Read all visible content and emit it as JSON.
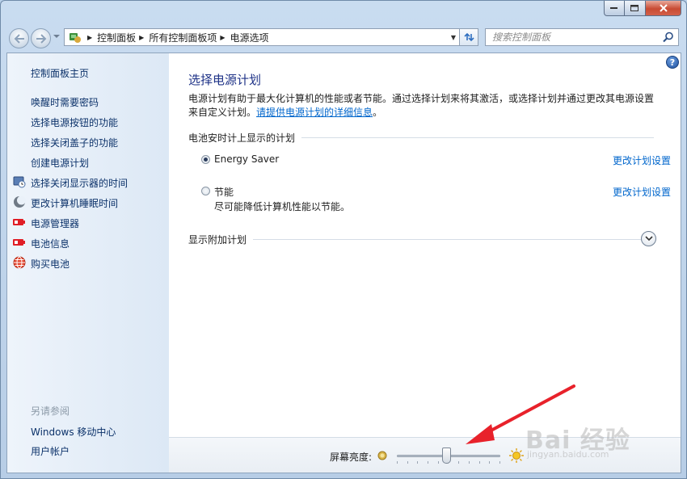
{
  "window": {
    "minimize_label": "—",
    "close_label": "✕"
  },
  "navbar": {
    "breadcrumbs": [
      "控制面板",
      "所有控制面板项",
      "电源选项"
    ],
    "search_placeholder": "搜索控制面板"
  },
  "sidebar": {
    "home_label": "控制面板主页",
    "links": [
      {
        "label": "唤醒时需要密码",
        "icon": ""
      },
      {
        "label": "选择电源按钮的功能",
        "icon": ""
      },
      {
        "label": "选择关闭盖子的功能",
        "icon": ""
      },
      {
        "label": "创建电源计划",
        "icon": ""
      },
      {
        "label": "选择关闭显示器的时间",
        "icon": "monitor-clock-icon"
      },
      {
        "label": "更改计算机睡眠时间",
        "icon": "moon-icon"
      },
      {
        "label": "电源管理器",
        "icon": "battery-red-icon"
      },
      {
        "label": "电池信息",
        "icon": "battery-red-icon"
      },
      {
        "label": "购买电池",
        "icon": "globe-icon"
      }
    ],
    "see_also_heading": "另请参阅",
    "see_also_links": [
      "Windows 移动中心",
      "用户帐户"
    ]
  },
  "main": {
    "title": "选择电源计划",
    "intro_text": "电源计划有助于最大化计算机的性能或者节能。通过选择计划来将其激活，或选择计划并通过更改其电源设置来自定义计划。",
    "intro_link": "请提供电源计划的详细信息",
    "intro_period": "。",
    "battery_section_heading": "电池安时计上显示的计划",
    "plans": [
      {
        "name": "Energy Saver",
        "description": "",
        "checked": true,
        "change_label": "更改计划设置"
      },
      {
        "name": "节能",
        "description": "尽可能降低计算机性能以节能。",
        "checked": false,
        "change_label": "更改计划设置"
      }
    ],
    "additional_plans_heading": "显示附加计划",
    "help_label": "?"
  },
  "bottom_bar": {
    "brightness_label": "屏幕亮度:",
    "brightness_level_percent": 48
  },
  "watermark": {
    "logo_text": "Bai 经验",
    "url_text": "jingyan.baidu.com"
  },
  "colors": {
    "title_blue": "#1e3287",
    "link_blue": "#0066cc",
    "sidebar_link": "#0c326a",
    "annotation_red": "#e8222b"
  }
}
